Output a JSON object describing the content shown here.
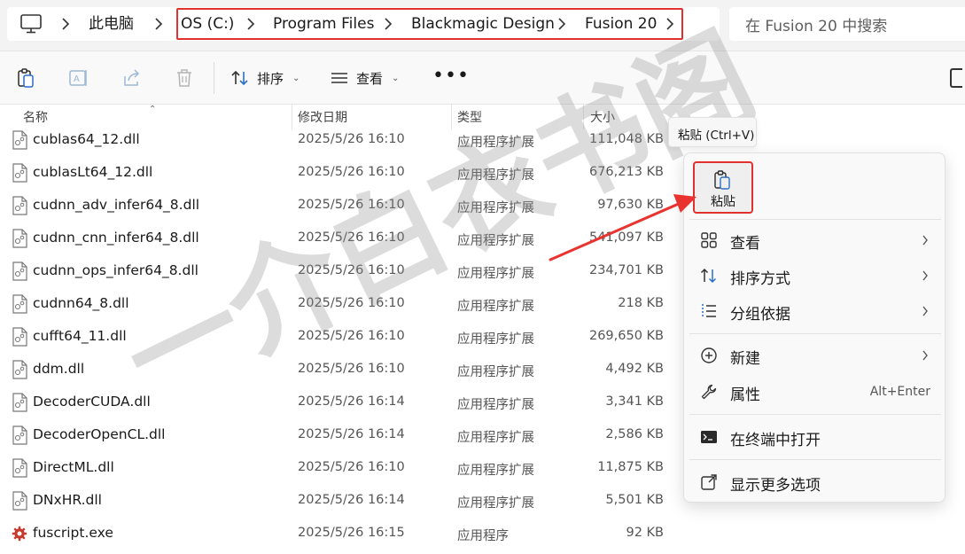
{
  "address_bar": {
    "root": "此电脑",
    "crumbs": [
      "OS (C:)",
      "Program Files",
      "Blackmagic Design",
      "Fusion 20"
    ],
    "icon": "monitor-icon"
  },
  "search": {
    "placeholder": "在 Fusion 20 中搜索"
  },
  "toolbar": {
    "icons": [
      "paste-icon",
      "rename-icon",
      "share-icon",
      "delete-icon"
    ],
    "sort_label": "排序",
    "view_label": "查看",
    "more_label": "•••"
  },
  "columns": {
    "name": "名称",
    "date": "修改日期",
    "type": "类型",
    "size": "大小"
  },
  "files": [
    {
      "name": "cublas64_12.dll",
      "date": "2025/5/26 16:10",
      "type": "应用程序扩展",
      "size": "111,048 KB"
    },
    {
      "name": "cublasLt64_12.dll",
      "date": "2025/5/26 16:10",
      "type": "应用程序扩展",
      "size": "676,213 KB"
    },
    {
      "name": "cudnn_adv_infer64_8.dll",
      "date": "2025/5/26 16:10",
      "type": "应用程序扩展",
      "size": "97,630 KB"
    },
    {
      "name": "cudnn_cnn_infer64_8.dll",
      "date": "2025/5/26 16:10",
      "type": "应用程序扩展",
      "size": "541,097 KB"
    },
    {
      "name": "cudnn_ops_infer64_8.dll",
      "date": "2025/5/26 16:10",
      "type": "应用程序扩展",
      "size": "234,701 KB"
    },
    {
      "name": "cudnn64_8.dll",
      "date": "2025/5/26 16:10",
      "type": "应用程序扩展",
      "size": "218 KB"
    },
    {
      "name": "cufft64_11.dll",
      "date": "2025/5/26 16:10",
      "type": "应用程序扩展",
      "size": "269,650 KB"
    },
    {
      "name": "ddm.dll",
      "date": "2025/5/26 16:10",
      "type": "应用程序扩展",
      "size": "4,492 KB"
    },
    {
      "name": "DecoderCUDA.dll",
      "date": "2025/5/26 16:14",
      "type": "应用程序扩展",
      "size": "3,341 KB"
    },
    {
      "name": "DecoderOpenCL.dll",
      "date": "2025/5/26 16:14",
      "type": "应用程序扩展",
      "size": "2,586 KB"
    },
    {
      "name": "DirectML.dll",
      "date": "2025/5/26 16:10",
      "type": "应用程序扩展",
      "size": "11,875 KB"
    },
    {
      "name": "DNxHR.dll",
      "date": "2025/5/26 16:14",
      "type": "应用程序扩展",
      "size": "5,501 KB"
    },
    {
      "name": "fuscript.exe",
      "date": "2025/5/26 16:15",
      "type": "应用程序",
      "size": "92 KB"
    }
  ],
  "tooltip": {
    "text": "粘贴 (Ctrl+V)"
  },
  "context_menu": {
    "paste_label": "粘贴",
    "items": [
      {
        "label": "查看",
        "icon": "grid-icon",
        "submenu": true
      },
      {
        "label": "排序方式",
        "icon": "sort-icon",
        "submenu": true
      },
      {
        "label": "分组依据",
        "icon": "group-icon",
        "submenu": true
      },
      {
        "label": "新建",
        "icon": "plus-circle-icon",
        "submenu": true
      },
      {
        "label": "属性",
        "icon": "wrench-icon",
        "shortcut": "Alt+Enter"
      },
      {
        "label": "在终端中打开",
        "icon": "terminal-icon"
      },
      {
        "label": "显示更多选项",
        "icon": "external-icon"
      }
    ]
  },
  "colors": {
    "highlight": "#e0312f",
    "arrow": "#e8332f",
    "accent": "#0067c0"
  },
  "watermark": {
    "text": "一介白衣书阁"
  }
}
